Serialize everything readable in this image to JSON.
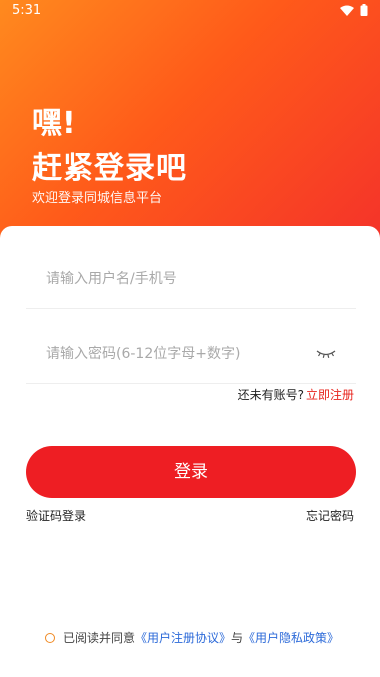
{
  "status_bar": {
    "time": "5:31"
  },
  "hero": {
    "greeting": "嘿!",
    "headline": "赶紧登录吧",
    "subtitle": "欢迎登录同城信息平台"
  },
  "form": {
    "username_placeholder": "请输入用户名/手机号",
    "password_placeholder": "请输入密码(6-12位字母+数字)",
    "no_account_text": "还未有账号?",
    "register_link": "立即注册",
    "login_button": "登录",
    "sms_login": "验证码登录",
    "forgot_password": "忘记密码"
  },
  "agreement": {
    "prefix": "已阅读并同意",
    "user_agreement": "《用户注册协议》",
    "conjunction": "与",
    "privacy_policy": "《用户隐私政策》"
  },
  "colors": {
    "brand_red": "#ee1e23",
    "gradient_start": "#ff8a1e",
    "gradient_end": "#f4322a",
    "link_blue": "#2c6ad9"
  }
}
